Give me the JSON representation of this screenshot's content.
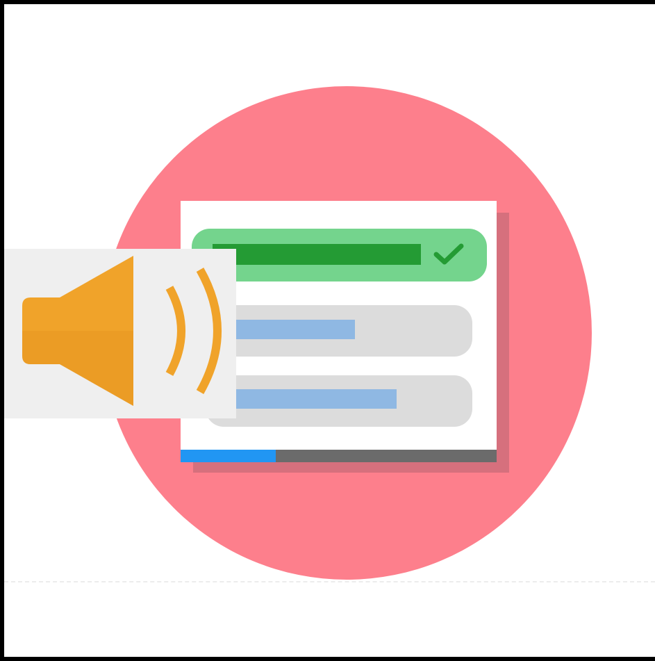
{
  "colors": {
    "background": "#ffffff",
    "frame_border": "#000000",
    "circle": "#fd7f8c",
    "card_shadow": "#d6707d",
    "correct_option_bg": "#74d48d",
    "correct_option_bar": "#249b34",
    "check": "#249b34",
    "option_bg": "#dcdcdc",
    "option_bar": "#8fb8e3",
    "progress_track": "#6b6b6b",
    "progress_fill": "#2196f3",
    "speaker": "#f0a32a",
    "speaker_shade": "#e28f1d",
    "speaker_panel": "#efefef"
  },
  "icons": {
    "check": "check-icon",
    "speaker": "speaker-sound-icon"
  },
  "quiz": {
    "options": [
      {
        "state": "correct"
      },
      {
        "state": "neutral"
      },
      {
        "state": "neutral"
      }
    ],
    "progress_fraction": 0.3
  }
}
